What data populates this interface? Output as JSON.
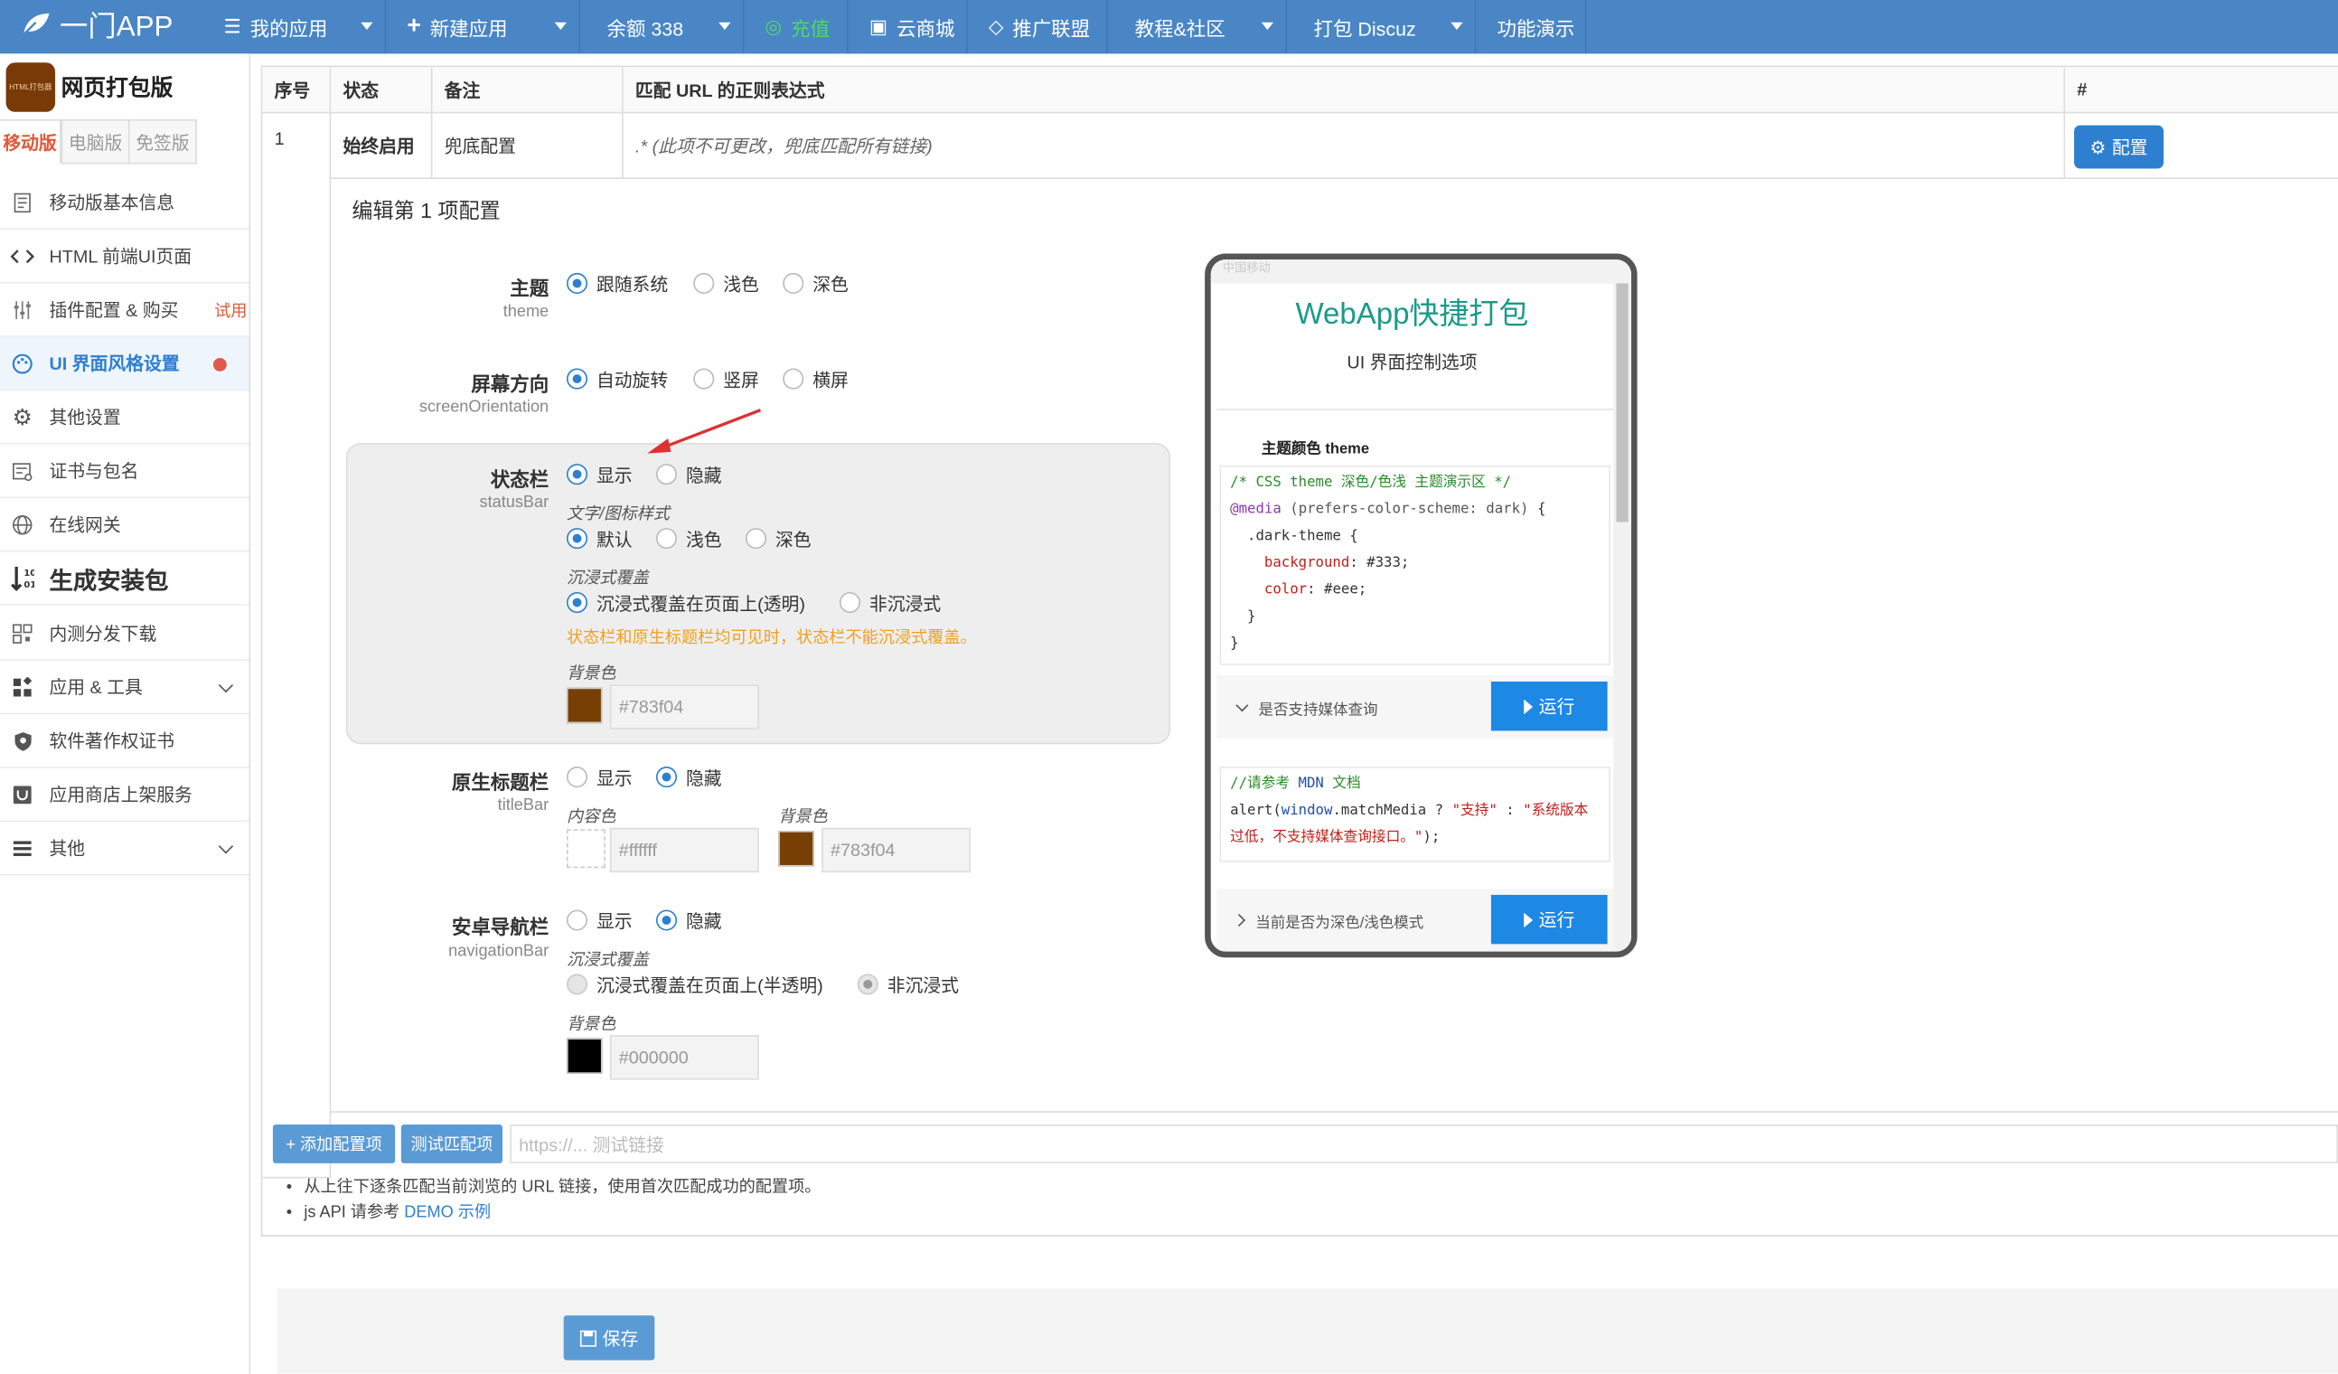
{
  "topbar": {
    "logo": "一门APP",
    "items": [
      {
        "icon": "☰",
        "label": "我的应用"
      },
      {
        "icon": "+",
        "label": "新建应用"
      },
      {
        "icon": "",
        "label": "余额 338"
      },
      {
        "icon": "◎",
        "label": "充值"
      },
      {
        "icon": "▣",
        "label": "云商城"
      },
      {
        "icon": "◇",
        "label": "推广联盟"
      },
      {
        "icon": "",
        "label": "教程&社区"
      },
      {
        "icon": "",
        "label": "打包 Discuz"
      },
      {
        "icon": "",
        "label": "功能演示"
      }
    ]
  },
  "sidebar": {
    "brand_logo_text": "HTML打包器",
    "brand_name": "网页打包版",
    "tabs": [
      "移动版",
      "电脑版",
      "免签版"
    ],
    "items": [
      {
        "label": "移动版基本信息",
        "icon": "doc"
      },
      {
        "label": "HTML 前端UI页面",
        "icon": "code"
      },
      {
        "label": "插件配置 & 购买",
        "icon": "sliders",
        "badge": "试用"
      },
      {
        "label": "UI 界面风格设置",
        "icon": "palette"
      },
      {
        "label": "其他设置",
        "icon": "gear"
      },
      {
        "label": "证书与包名",
        "icon": "cert"
      },
      {
        "label": "在线网关",
        "icon": "globe"
      },
      {
        "label": "生成安装包",
        "icon": "sort"
      },
      {
        "label": "内测分发下载",
        "icon": "qr"
      },
      {
        "label": "应用 & 工具",
        "icon": "apps"
      },
      {
        "label": "软件著作权证书",
        "icon": "shield"
      },
      {
        "label": "应用商店上架服务",
        "icon": "store"
      },
      {
        "label": "其他",
        "icon": "menu"
      }
    ]
  },
  "table": {
    "headers": [
      "序号",
      "状态",
      "备注",
      "匹配 URL 的正则表达式",
      "#"
    ],
    "row": {
      "index": "1",
      "status": "始终启用",
      "remark": "兜底配置",
      "regex": ".* (此项不可更改，兜底匹配所有链接)",
      "button": "配置"
    }
  },
  "form": {
    "title": "编辑第 1 项配置",
    "theme": {
      "label": "主题",
      "sub": "theme",
      "options": [
        "跟随系统",
        "浅色",
        "深色"
      ],
      "selected": "跟随系统"
    },
    "orientation": {
      "label": "屏幕方向",
      "sub": "screenOrientation",
      "options": [
        "自动旋转",
        "竖屏",
        "横屏"
      ],
      "selected": "自动旋转"
    },
    "statusBar": {
      "label": "状态栏",
      "sub": "statusBar",
      "options": [
        "显示",
        "隐藏"
      ],
      "selected": "显示",
      "text_style_label": "文字/图标样式",
      "text_style_options": [
        "默认",
        "浅色",
        "深色"
      ],
      "text_style_selected": "默认",
      "immersive_label": "沉浸式覆盖",
      "immersive_options": [
        "沉浸式覆盖在页面上(透明)",
        "非沉浸式"
      ],
      "immersive_selected": "沉浸式覆盖在页面上(透明)",
      "warning": "状态栏和原生标题栏均可见时，状态栏不能沉浸式覆盖。",
      "bg_label": "背景色",
      "bg_color": "#783f04"
    },
    "titleBar": {
      "label": "原生标题栏",
      "sub": "titleBar",
      "options": [
        "显示",
        "隐藏"
      ],
      "selected": "隐藏",
      "content_label": "内容色",
      "content_color": "#ffffff",
      "bg_label": "背景色",
      "bg_color": "#783f04"
    },
    "navBar": {
      "label": "安卓导航栏",
      "sub": "navigationBar",
      "options": [
        "显示",
        "隐藏"
      ],
      "selected": "隐藏",
      "immersive_label": "沉浸式覆盖",
      "immersive_options": [
        "沉浸式覆盖在页面上(半透明)",
        "非沉浸式"
      ],
      "immersive_selected": "非沉浸式",
      "bg_label": "背景色",
      "bg_color": "#000000"
    }
  },
  "phone": {
    "carrier": "中国移动",
    "title": "WebApp快捷打包",
    "subtitle": "UI 界面控制选项",
    "section": "主题颜色 theme",
    "run1": "是否支持媒体查询",
    "run2": "当前是否为深色/浅色模式",
    "run_label": "运行"
  },
  "bottom": {
    "add_btn": "+ 添加配置项",
    "test_btn": "测试匹配项",
    "test_placeholder": "https://... 测试链接",
    "note1": "从上往下逐条匹配当前浏览的 URL 链接，使用首次匹配成功的配置项。",
    "note2_prefix": "js API 请参考 ",
    "note2_link": "DEMO 示例",
    "save": "保存"
  },
  "colors": {
    "topbar": "#4a86c5",
    "accent": "#2f7fd0",
    "warning": "#f0a020",
    "recharge": "#4cd964"
  }
}
